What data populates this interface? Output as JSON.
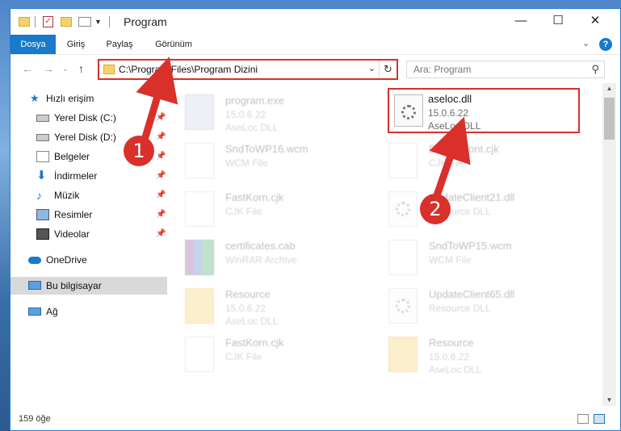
{
  "window": {
    "title": "Program"
  },
  "ribbon": {
    "tabs": [
      {
        "label": "Dosya",
        "active": true
      },
      {
        "label": "Giriş"
      },
      {
        "label": "Paylaş"
      },
      {
        "label": "Görünüm"
      }
    ]
  },
  "address": {
    "path": "C:\\Program Files\\Program Dizini"
  },
  "search": {
    "placeholder": "Ara: Program"
  },
  "sidebar": {
    "items": [
      {
        "label": "Hızlı erişim",
        "icon": "star-icon"
      },
      {
        "label": "Yerel Disk (C:)",
        "icon": "drive-icon",
        "pinned": true
      },
      {
        "label": "Yerel Disk (D:)",
        "icon": "drive-icon",
        "pinned": true
      },
      {
        "label": "Belgeler",
        "icon": "documents-icon",
        "pinned": true
      },
      {
        "label": "İndirmeler",
        "icon": "downloads-icon",
        "pinned": true
      },
      {
        "label": "Müzik",
        "icon": "music-icon",
        "pinned": true
      },
      {
        "label": "Resimler",
        "icon": "pictures-icon",
        "pinned": true
      },
      {
        "label": "Videolar",
        "icon": "videos-icon",
        "pinned": true
      },
      {
        "label": "OneDrive",
        "icon": "cloud-icon"
      },
      {
        "label": "Bu bilgisayar",
        "icon": "computer-icon",
        "selected": true
      },
      {
        "label": "Ağ",
        "icon": "network-icon"
      }
    ]
  },
  "files": {
    "left": [
      {
        "name": "program.exe",
        "line1": "15.0.6.22",
        "line2": "AseLoc DLL",
        "icon": "exe-icon"
      },
      {
        "name": "SndToWP16.wcm",
        "line1": "WCM File",
        "line2": "",
        "icon": "document-icon"
      },
      {
        "name": "FastKorn.cjk",
        "line1": "CJK File",
        "line2": "",
        "icon": "document-icon"
      },
      {
        "name": "certificates.cab",
        "line1": "WinRAR Archive",
        "line2": "",
        "icon": "archive-icon"
      },
      {
        "name": "Resource",
        "line1": "15.0.6.22",
        "line2": "AseLoc DLL",
        "icon": "folder-icon"
      },
      {
        "name": "FastKorn.cjk",
        "line1": "CJK File",
        "line2": "",
        "icon": "document-icon"
      }
    ],
    "right": [
      {
        "name": "aseloc.dll",
        "line1": "15.0.6.22",
        "line2": "AseLoc DLL",
        "icon": "dll-icon",
        "highlighted": true
      },
      {
        "name": "DefaultFont.cjk",
        "line1": "CJK File",
        "line2": "",
        "icon": "document-icon"
      },
      {
        "name": "UpdateClient21.dll",
        "line1": "Resource DLL",
        "line2": "",
        "icon": "dll-icon"
      },
      {
        "name": "SndToWP15.wcm",
        "line1": "WCM File",
        "line2": "",
        "icon": "document-icon"
      },
      {
        "name": "UpdateClient65.dll",
        "line1": "Resource DLL",
        "line2": "",
        "icon": "dll-icon"
      },
      {
        "name": "Resource",
        "line1": "15.0.6.22",
        "line2": "AseLoc DLL",
        "icon": "folder-icon"
      }
    ]
  },
  "status": {
    "count": "159 öğe"
  },
  "callouts": {
    "one": "1",
    "two": "2",
    "color": "#d9302c"
  }
}
